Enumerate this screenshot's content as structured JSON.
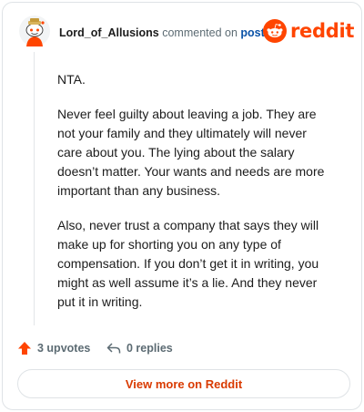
{
  "comment": {
    "author": "Lord_of_Allusions",
    "action_text": "commented on",
    "post_link": "post",
    "paragraphs": [
      "NTA.",
      "Never feel guilty about leaving a job. They are not your family and they ultimately will never care about you. The lying about the salary doesn’t matter. Your wants and needs are more important than any business.",
      "Also, never trust a company that says they will make up for shorting you on any type of compensation. If you don’t get it in writing, you might as well assume it’s a lie. And they never put it in writing."
    ]
  },
  "brand": {
    "name": "reddit",
    "color": "#ff4500",
    "icon": "reddit-logo-icon"
  },
  "actions": {
    "upvotes": "3 upvotes",
    "replies": "0 replies",
    "upvote_icon": "upvote-arrow-icon",
    "reply_icon": "reply-arrow-icon",
    "upvote_color": "#ff4500"
  },
  "footer": {
    "view_more": "View more on Reddit",
    "color": "#d93a00"
  }
}
